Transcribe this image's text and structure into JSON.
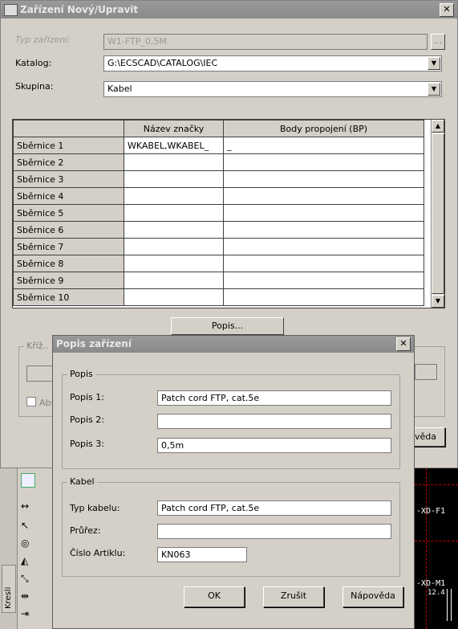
{
  "main": {
    "title": "Zařízení Nový/Upravit",
    "close": "✕",
    "typ_label": "Typ zařízení:",
    "typ_value": "W1-FTP_0,5M",
    "browse": "...",
    "katalog_label": "Katalog:",
    "katalog_value": "G:\\ECSCAD\\CATALOG\\IEC",
    "skupina_label": "Skupina:",
    "skupina_value": "Kabel",
    "grid": {
      "headers": [
        "",
        "Název značky",
        "Body propojení (BP)"
      ],
      "rows": [
        {
          "name": "Sběrnice 1",
          "znacka": "WKABEL,WKABEL_",
          "body": "_"
        },
        {
          "name": "Sběrnice 2",
          "znacka": "",
          "body": ""
        },
        {
          "name": "Sběrnice 3",
          "znacka": "",
          "body": ""
        },
        {
          "name": "Sběrnice 4",
          "znacka": "",
          "body": ""
        },
        {
          "name": "Sběrnice 5",
          "znacka": "",
          "body": ""
        },
        {
          "name": "Sběrnice 6",
          "znacka": "",
          "body": ""
        },
        {
          "name": "Sběrnice 7",
          "znacka": "",
          "body": ""
        },
        {
          "name": "Sběrnice 8",
          "znacka": "",
          "body": ""
        },
        {
          "name": "Sběrnice 9",
          "znacka": "",
          "body": ""
        },
        {
          "name": "Sběrnice 10",
          "znacka": "",
          "body": ""
        }
      ]
    },
    "popis_button": "Popis...",
    "partial_group": "Kříž.. r",
    "partial_check": "Abs",
    "partial_button": "ověda"
  },
  "popis_dialog": {
    "title": "Popis zařízení",
    "close": "✕",
    "popis_group": "Popis",
    "popis1_label": "Popis 1:",
    "popis1_value": "Patch cord FTP, cat.5e",
    "popis2_label": "Popis 2:",
    "popis2_value": "",
    "popis3_label": "Popis 3:",
    "popis3_value": "0,5m",
    "kabel_group": "Kabel",
    "typ_kabelu_label": "Typ kabelu:",
    "typ_kabelu_value": "Patch cord FTP, cat.5e",
    "prurez_label": "Průřez:",
    "prurez_value": "",
    "artikl_label": "Číslo Artiklu:",
    "artikl_value": "KN063",
    "ok": "OK",
    "zrusit": "Zrušit",
    "napoveda": "Nápověda"
  },
  "background": {
    "kresli_tab": "Kresli",
    "cad_label1": "-XD-F1",
    "cad_label2": "-XD-M1",
    "cad_label3": "12.4"
  }
}
